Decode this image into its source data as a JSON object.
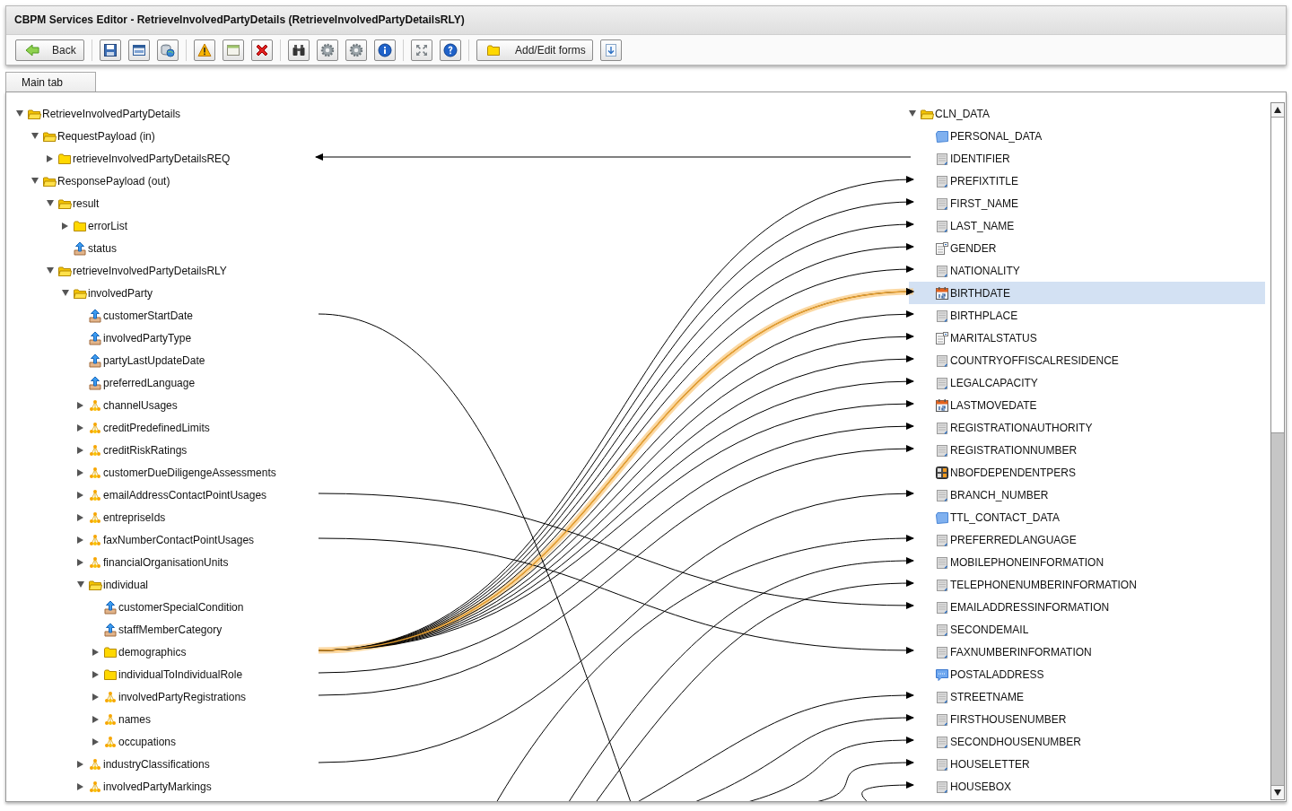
{
  "window": {
    "title": "CBPM Services Editor - RetrieveInvolvedPartyDetails (RetrieveInvolvedPartyDetailsRLY)"
  },
  "toolbar": {
    "buttons": [
      {
        "label": "Back"
      },
      {
        "label": "Add/Edit forms"
      }
    ]
  },
  "tabs": [
    {
      "label": "Main tab",
      "selected": true
    }
  ],
  "source_tree": [
    {
      "label": "RetrieveInvolvedPartyDetails",
      "kind": "folder",
      "expanded": true,
      "children": [
        {
          "label": "RequestPayload (in)",
          "kind": "folder",
          "expanded": true,
          "children": [
            {
              "label": "retrieveInvolvedPartyDetailsREQ",
              "kind": "folder",
              "expanded": false
            }
          ]
        },
        {
          "label": "ResponsePayload (out)",
          "kind": "folder",
          "expanded": true,
          "children": [
            {
              "label": "result",
              "kind": "folder",
              "expanded": true,
              "children": [
                {
                  "label": "errorList",
                  "kind": "folder",
                  "expanded": false
                },
                {
                  "label": "status",
                  "kind": "field"
                }
              ]
            },
            {
              "label": "retrieveInvolvedPartyDetailsRLY",
              "kind": "folder",
              "expanded": true,
              "children": [
                {
                  "label": "involvedParty",
                  "kind": "folder",
                  "expanded": true,
                  "children": [
                    {
                      "label": "customerStartDate",
                      "kind": "field"
                    },
                    {
                      "label": "involvedPartyType",
                      "kind": "field"
                    },
                    {
                      "label": "partyLastUpdateDate",
                      "kind": "field"
                    },
                    {
                      "label": "preferredLanguage",
                      "kind": "field"
                    },
                    {
                      "label": "channelUsages",
                      "kind": "group",
                      "expanded": false
                    },
                    {
                      "label": "creditPredefinedLimits",
                      "kind": "group",
                      "expanded": false
                    },
                    {
                      "label": "creditRiskRatings",
                      "kind": "group",
                      "expanded": false
                    },
                    {
                      "label": "customerDueDiligengeAssessments",
                      "kind": "group",
                      "expanded": false
                    },
                    {
                      "label": "emailAddressContactPointUsages",
                      "kind": "group",
                      "expanded": false
                    },
                    {
                      "label": "entrepriseIds",
                      "kind": "group",
                      "expanded": false
                    },
                    {
                      "label": "faxNumberContactPointUsages",
                      "kind": "group",
                      "expanded": false
                    },
                    {
                      "label": "financialOrganisationUnits",
                      "kind": "group",
                      "expanded": false
                    },
                    {
                      "label": "individual",
                      "kind": "folder",
                      "expanded": true,
                      "children": [
                        {
                          "label": "customerSpecialCondition",
                          "kind": "field"
                        },
                        {
                          "label": "staffMemberCategory",
                          "kind": "field"
                        },
                        {
                          "label": "demographics",
                          "kind": "folder",
                          "expanded": false
                        },
                        {
                          "label": "individualToIndividualRole",
                          "kind": "folder",
                          "expanded": false
                        },
                        {
                          "label": "involvedPartyRegistrations",
                          "kind": "group",
                          "expanded": false
                        },
                        {
                          "label": "names",
                          "kind": "group",
                          "expanded": false
                        },
                        {
                          "label": "occupations",
                          "kind": "group",
                          "expanded": false
                        }
                      ]
                    },
                    {
                      "label": "industryClassifications",
                      "kind": "group",
                      "expanded": false
                    },
                    {
                      "label": "involvedPartyMarkings",
                      "kind": "group",
                      "expanded": false
                    }
                  ]
                }
              ]
            }
          ]
        }
      ]
    }
  ],
  "target_tree": [
    {
      "label": "CLN_DATA",
      "kind": "folder",
      "expanded": true,
      "selected": false,
      "children": [
        {
          "label": "PERSONAL_DATA",
          "kind": "section",
          "selected": false
        },
        {
          "label": "IDENTIFIER",
          "kind": "text",
          "selected": false
        },
        {
          "label": "PREFIXTITLE",
          "kind": "text",
          "selected": false
        },
        {
          "label": "FIRST_NAME",
          "kind": "text",
          "selected": false
        },
        {
          "label": "LAST_NAME",
          "kind": "text",
          "selected": false
        },
        {
          "label": "GENDER",
          "kind": "list",
          "selected": false
        },
        {
          "label": "NATIONALITY",
          "kind": "text",
          "selected": false
        },
        {
          "label": "BIRTHDATE",
          "kind": "date",
          "selected": true
        },
        {
          "label": "BIRTHPLACE",
          "kind": "text",
          "selected": false
        },
        {
          "label": "MARITALSTATUS",
          "kind": "list",
          "selected": false
        },
        {
          "label": "COUNTRYOFFISCALRESIDENCE",
          "kind": "text",
          "selected": false
        },
        {
          "label": "LEGALCAPACITY",
          "kind": "text",
          "selected": false
        },
        {
          "label": "LASTMOVEDATE",
          "kind": "date",
          "selected": false
        },
        {
          "label": "REGISTRATIONAUTHORITY",
          "kind": "text",
          "selected": false
        },
        {
          "label": "REGISTRATIONNUMBER",
          "kind": "text",
          "selected": false
        },
        {
          "label": "NBOFDEPENDENTPERS",
          "kind": "number",
          "selected": false
        },
        {
          "label": "BRANCH_NUMBER",
          "kind": "text",
          "selected": false
        },
        {
          "label": "TTL_CONTACT_DATA",
          "kind": "section",
          "selected": false
        },
        {
          "label": "PREFERREDLANGUAGE",
          "kind": "text",
          "selected": false
        },
        {
          "label": "MOBILEPHONEINFORMATION",
          "kind": "text",
          "selected": false
        },
        {
          "label": "TELEPHONENUMBERINFORMATION",
          "kind": "text",
          "selected": false
        },
        {
          "label": "EMAILADDRESSINFORMATION",
          "kind": "text",
          "selected": false
        },
        {
          "label": "SECONDEMAIL",
          "kind": "text",
          "selected": false
        },
        {
          "label": "FAXNUMBERINFORMATION",
          "kind": "text",
          "selected": false
        },
        {
          "label": "POSTALADDRESS",
          "kind": "address",
          "selected": false
        },
        {
          "label": "STREETNAME",
          "kind": "text",
          "selected": false
        },
        {
          "label": "FIRSTHOUSENUMBER",
          "kind": "text",
          "selected": false
        },
        {
          "label": "SECONDHOUSENUMBER",
          "kind": "text",
          "selected": false
        },
        {
          "label": "HOUSELETTER",
          "kind": "text",
          "selected": false
        },
        {
          "label": "HOUSEBOX",
          "kind": "text",
          "selected": false
        }
      ]
    }
  ]
}
